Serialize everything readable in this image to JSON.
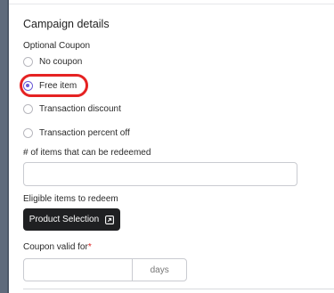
{
  "section": {
    "title": "Campaign details"
  },
  "optional_coupon": {
    "label": "Optional Coupon",
    "options": [
      {
        "label": "No coupon",
        "checked": false
      },
      {
        "label": "Free item",
        "checked": true
      },
      {
        "label": "Transaction discount",
        "checked": false
      },
      {
        "label": "Transaction percent off",
        "checked": false
      }
    ]
  },
  "items_redeemable": {
    "label": "# of items that can be redeemed",
    "value": ""
  },
  "eligible_items": {
    "label": "Eligible items to redeem",
    "button_label": "Product Selection",
    "button_icon": "external-link-icon"
  },
  "coupon_valid": {
    "label": "Coupon valid for",
    "required_mark": "*",
    "value": "",
    "suffix": "days"
  },
  "colors": {
    "accent": "#6b5bd6",
    "highlight": "#e52222",
    "button_bg": "#1f2022",
    "required": "#dd2222"
  }
}
